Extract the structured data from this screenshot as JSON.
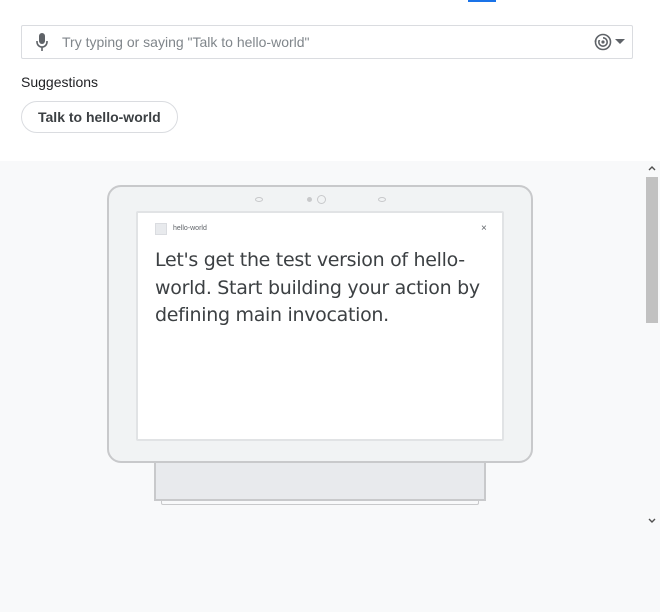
{
  "input": {
    "placeholder": "Try typing or saying \"Talk to hello-world\"",
    "mic_icon": "mic-icon",
    "device_icon": "smart-display-icon",
    "dropdown_icon": "caret-down-icon"
  },
  "suggestions": {
    "label": "Suggestions",
    "chips": [
      "Talk to hello-world"
    ]
  },
  "preview": {
    "app_name": "hello-world",
    "close_label": "×",
    "message": "Let's get the test version of hello-world. Start building your action by defining main invocation."
  },
  "colors": {
    "accent": "#1a73e8",
    "preview_bg": "#f8f9fa",
    "text": "#3c4043"
  }
}
